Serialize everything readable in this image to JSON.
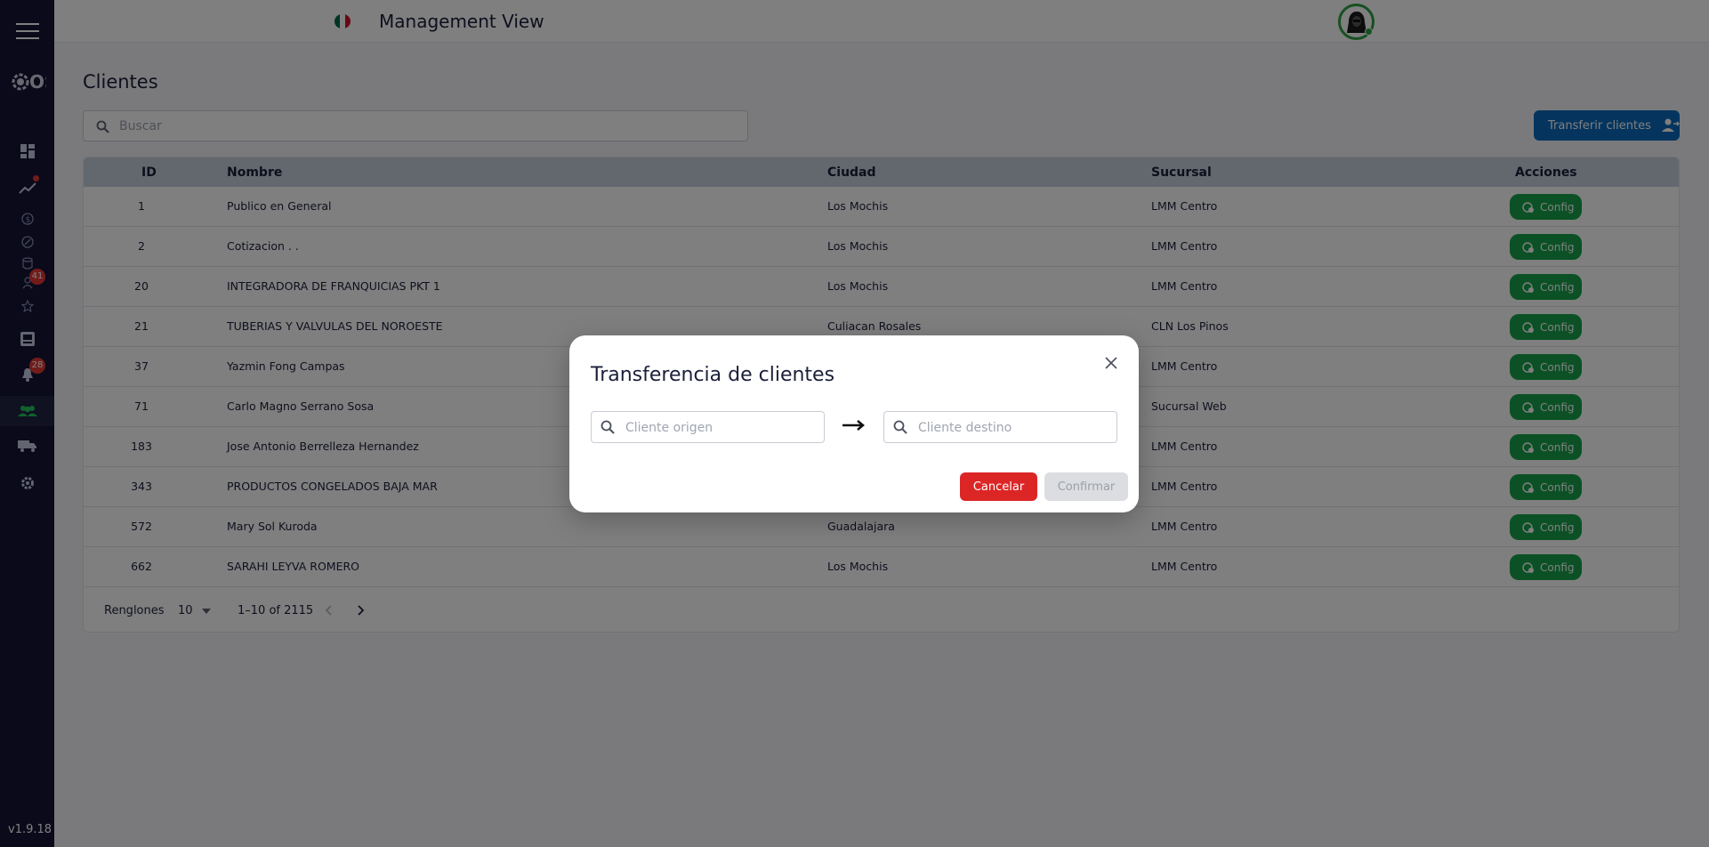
{
  "app": {
    "title": "Management View",
    "version": "v1.9.18",
    "logo_text": "OS"
  },
  "sidebar": {
    "items": [
      {
        "icon": "menu-icon"
      },
      {
        "icon": "logo"
      },
      {
        "icon": "dashboard-icon"
      },
      {
        "icon": "trending-up-icon",
        "dot": true
      },
      {
        "icon": "dollar-icon"
      },
      {
        "icon": "discount-icon"
      },
      {
        "icon": "database-icon"
      },
      {
        "icon": "contacts-icon",
        "badge": "41"
      },
      {
        "icon": "star-icon"
      },
      {
        "icon": "inbox-icon"
      },
      {
        "icon": "bell-icon",
        "badge": "28"
      },
      {
        "icon": "people-icon",
        "active": true
      },
      {
        "icon": "truck-icon"
      },
      {
        "icon": "gear-icon"
      }
    ],
    "accent_color": "#22c55e"
  },
  "page": {
    "title": "Clientes",
    "search_placeholder": "Buscar",
    "transfer_button": "Transferir clientes"
  },
  "table": {
    "columns": {
      "id": "ID",
      "name": "Nombre",
      "city": "Ciudad",
      "branch": "Sucursal",
      "actions": "Acciones"
    },
    "config_label": "Config",
    "rows": [
      {
        "id": "1",
        "name": "Publico en General",
        "city": "Los Mochis",
        "branch": "LMM Centro"
      },
      {
        "id": "2",
        "name": "Cotizacion . .",
        "city": "Los Mochis",
        "branch": "LMM Centro"
      },
      {
        "id": "20",
        "name": "INTEGRADORA DE FRANQUICIAS PKT 1",
        "city": "Los Mochis",
        "branch": "LMM Centro"
      },
      {
        "id": "21",
        "name": "TUBERIAS Y VALVULAS DEL NOROESTE",
        "city": "Culiacan Rosales",
        "branch": "CLN Los Pinos"
      },
      {
        "id": "37",
        "name": "Yazmin Fong Campas",
        "city": "",
        "branch": "LMM Centro"
      },
      {
        "id": "71",
        "name": "Carlo Magno Serrano Sosa",
        "city": "",
        "branch": "Sucursal Web"
      },
      {
        "id": "183",
        "name": "Jose Antonio Berrelleza Hernandez",
        "city": "",
        "branch": "LMM Centro"
      },
      {
        "id": "343",
        "name": "PRODUCTOS CONGELADOS BAJA MAR",
        "city": "",
        "branch": "LMM Centro"
      },
      {
        "id": "572",
        "name": "Mary Sol Kuroda",
        "city": "Guadalajara",
        "branch": "LMM Centro"
      },
      {
        "id": "662",
        "name": "SARAHI LEYVA ROMERO",
        "city": "Los Mochis",
        "branch": "LMM Centro"
      }
    ],
    "pagination": {
      "rows_label": "Renglones",
      "rows_per_page": "10",
      "range": "1–10 of 2115"
    }
  },
  "modal": {
    "title": "Transferencia de clientes",
    "origin_placeholder": "Cliente origen",
    "destination_placeholder": "Cliente destino",
    "cancel_label": "Cancelar",
    "confirm_label": "Confirmar"
  },
  "colors": {
    "sidebar_bg": "#141537",
    "primary_blue": "#0a6bbd",
    "config_green": "#16a34a",
    "cancel_red": "#dc2626",
    "badge_red": "#e53935"
  }
}
